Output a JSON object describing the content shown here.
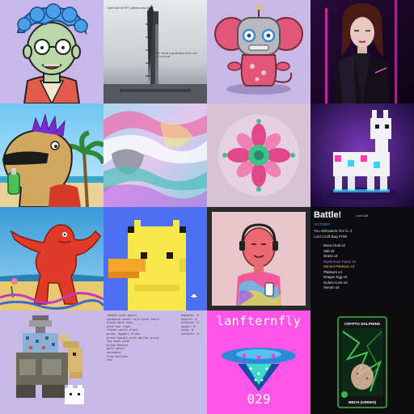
{
  "tiles": [
    {
      "icon": "cartoon-man-portrait-icon"
    },
    {
      "icon": "rocket-launch-photo-icon",
      "caption_top": "I can't even let NFT collectors and artists",
      "caption_mid": "the future. Never a generation of the rest of space we know"
    },
    {
      "icon": "robot-mouse-icon"
    },
    {
      "icon": "cyber-woman-portrait-icon"
    },
    {
      "icon": "punk-creature-beach-icon"
    },
    {
      "icon": "abstract-fluid-art-icon"
    },
    {
      "icon": "kaleidoscope-flower-icon"
    },
    {
      "icon": "voxel-llama-icon"
    },
    {
      "icon": "red-monster-beach-icon"
    },
    {
      "icon": "pixel-duck-icon"
    },
    {
      "icon": "pink-character-headphones-icon"
    },
    {
      "icon": "battle-panel"
    },
    {
      "icon": "pixel-creature-robot-icon"
    },
    {
      "icon": "loot-list-panel"
    },
    {
      "icon": "lanternfly-ufo-icon",
      "title": "lanfternfly",
      "number": "029"
    },
    {
      "icon": "crypto-dolphin-card-icon",
      "title": "CRYPTO DOLPHINS",
      "name": "MECH (GREEN)"
    }
  ],
  "battle": {
    "title": "Battle!",
    "subtitle": "Loot Craft",
    "victory": "VICTORY",
    "defeated": "You defeated4 Orc lv. 4",
    "bag": "Loot Craft Bag #796",
    "items": [
      "Moon Dust x2",
      "Salt x5",
      "Grass x4",
      "Mysterious Topaz x5",
      "Sacred Platinum x3",
      "Platinum x4",
      "Dragon Egg x3",
      "Golem Core x2",
      "Venom x4"
    ],
    "item_colors": [
      "#e8e8e8",
      "#e8e8e8",
      "#e8e8e8",
      "#b07cf0",
      "#e8c84a",
      "#e8e8e8",
      "#e8e8e8",
      "#e8e8e8",
      "#e8e8e8"
    ]
  },
  "loot": {
    "left": [
      "zombie with penis",
      "sandwich mouth with back teeth",
      "black derp eyes",
      "blue eye right",
      "flower pants black",
      "green joggers blues",
      "black hoodie with dollar print",
      "toy mask pink",
      "black beanie",
      "gold watch",
      "sneakers",
      "frog balloon",
      "cap"
    ],
    "right": [
      "empathy: 0",
      "health: 0",
      "offense: 0",
      "power: 0",
      "swag: 0",
      "stealth: 0"
    ]
  },
  "colors": {
    "lavender": "#c7b8e6",
    "battle_bg": "#0c0c10",
    "lanternfly_bg": "#ff55e8",
    "dolphin_bg": "#0d0d0d",
    "duck_bg": "#4a6ff0"
  }
}
